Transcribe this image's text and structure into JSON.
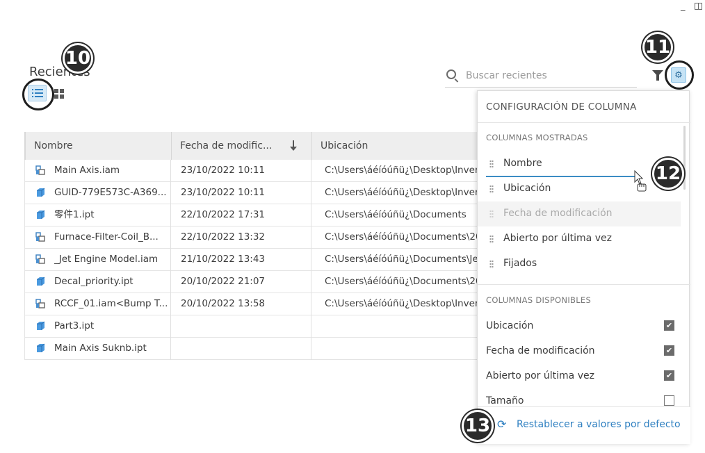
{
  "window": {
    "minimize_glyph": "_"
  },
  "page": {
    "title": "Recientes"
  },
  "search": {
    "placeholder": "Buscar recientes"
  },
  "callouts": {
    "c10": "10",
    "c11": "11",
    "c12": "12",
    "c13": "13"
  },
  "table": {
    "headers": {
      "name": "Nombre",
      "date": "Fecha de modific...",
      "location": "Ubicación"
    },
    "rows": [
      {
        "name": "Main Axis.iam",
        "date": "23/10/2022 10:11",
        "location": "C:\\Users\\áéíóúñü¿\\Desktop\\Inver",
        "icon": "assembly-icon"
      },
      {
        "name": "GUID-779E573C-A369...",
        "date": "23/10/2022 10:11",
        "location": "C:\\Users\\áéíóúñü¿\\Desktop\\Inver",
        "icon": "part-icon"
      },
      {
        "name": "零件1.ipt",
        "date": "22/10/2022 17:31",
        "location": "C:\\Users\\áéíóúñü¿\\Documents",
        "icon": "part-icon"
      },
      {
        "name": "Furnace-Filter-Coil_B...",
        "date": "22/10/2022 13:32",
        "location": "C:\\Users\\áéíóúñü¿\\Documents\\20",
        "icon": "assembly-icon"
      },
      {
        "name": "_Jet Engine Model.iam",
        "date": "21/10/2022 13:43",
        "location": "C:\\Users\\áéíóúñü¿\\Documents\\Je",
        "icon": "assembly-icon"
      },
      {
        "name": "Decal_priority.ipt",
        "date": "20/10/2022 21:07",
        "location": "C:\\Users\\áéíóúñü¿\\Documents\\20",
        "icon": "part-icon"
      },
      {
        "name": "RCCF_01.iam<Bump T...",
        "date": "20/10/2022 13:58",
        "location": "C:\\Users\\áéíóúñü¿\\Desktop\\Inver",
        "icon": "assembly-icon"
      },
      {
        "name": "Part3.ipt",
        "date": "",
        "location": "",
        "icon": "part-icon"
      },
      {
        "name": "Main Axis Suknb.ipt",
        "date": "",
        "location": "",
        "icon": "part-icon"
      }
    ]
  },
  "column_panel": {
    "title": "CONFIGURACIÓN DE COLUMNA",
    "shown_label": "COLUMNAS MOSTRADAS",
    "shown": [
      "Nombre",
      "Ubicación",
      "Fecha de modificación",
      "Abierto por última vez",
      "Fijados"
    ],
    "available_label": "COLUMNAS DISPONIBLES",
    "available": [
      {
        "label": "Ubicación",
        "checked": true
      },
      {
        "label": "Fecha de modificación",
        "checked": true
      },
      {
        "label": "Abierto por última vez",
        "checked": true
      },
      {
        "label": "Tamaño",
        "checked": false
      }
    ],
    "reset_label": "Restablecer a valores por defecto"
  },
  "colors": {
    "accent": "#2f80c1",
    "selected_bg": "#d7eaf7",
    "callout": "#2b2b2b"
  }
}
